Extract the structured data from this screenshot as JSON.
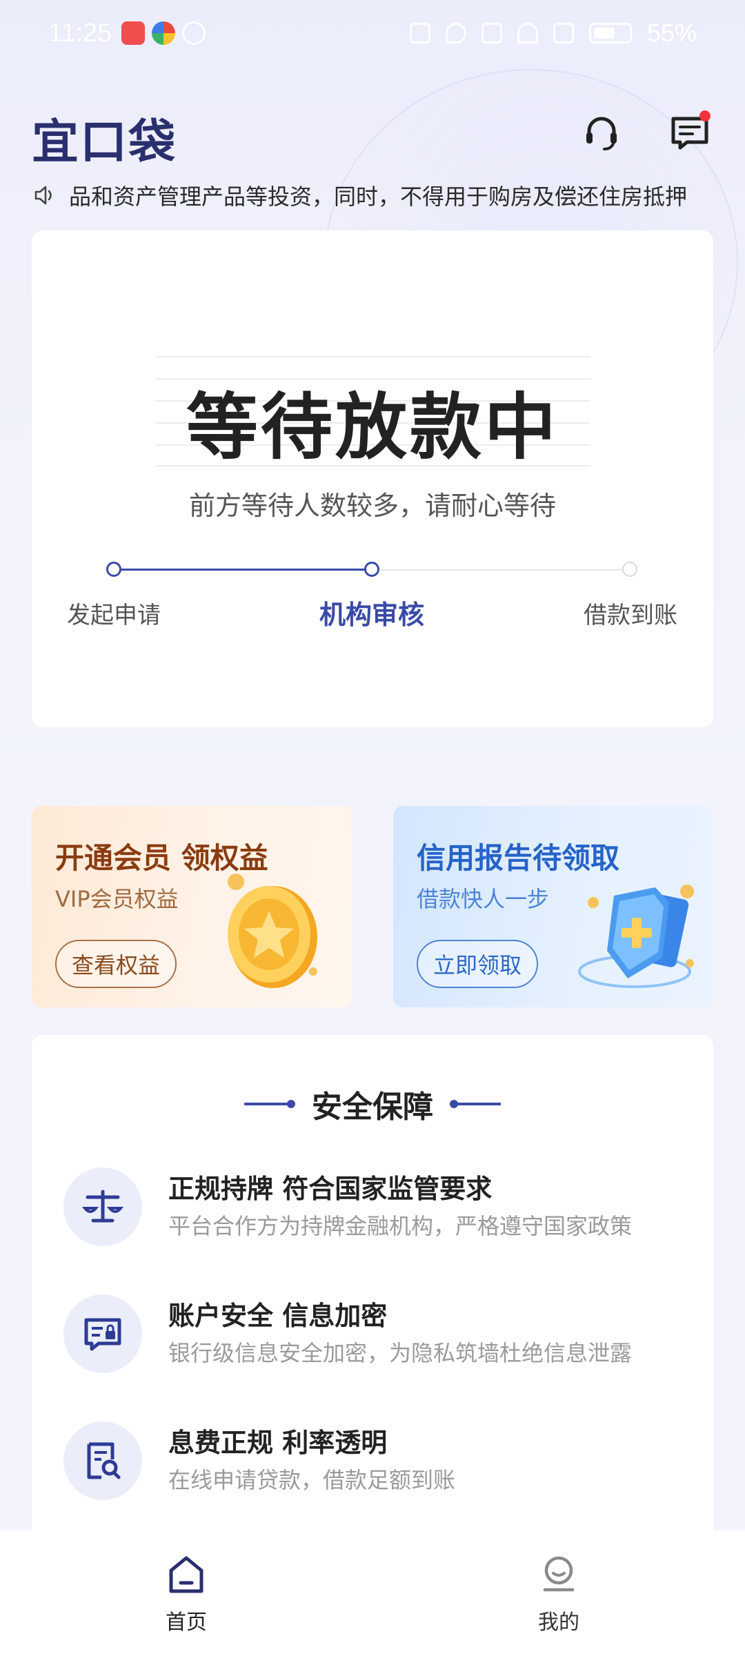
{
  "status_bar": {
    "time": "11:25",
    "battery": "55%"
  },
  "header": {
    "logo": "宜口袋",
    "icons": [
      "headset-icon",
      "message-icon"
    ]
  },
  "notice": {
    "text": "品和资产管理产品等投资，同时，不得用于购房及偿还住房抵押"
  },
  "loan_status": {
    "title": "等待放款中",
    "subtitle": "前方等待人数较多，请耐心等待",
    "steps": [
      {
        "label": "发起申请",
        "state": "done"
      },
      {
        "label": "机构审核",
        "state": "current"
      },
      {
        "label": "借款到账",
        "state": "pending"
      }
    ],
    "accent_color": "#3a4aa6"
  },
  "promos": {
    "vip": {
      "title": "开通会员 领权益",
      "subtitle": "VIP会员权益",
      "button": "查看权益"
    },
    "credit": {
      "title": "信用报告待领取",
      "subtitle": "借款快人一步",
      "button": "立即领取"
    }
  },
  "safety": {
    "title": "安全保障",
    "features": [
      {
        "icon": "scale-icon",
        "title": "正规持牌 符合国家监管要求",
        "desc": "平台合作方为持牌金融机构，严格遵守国家政策"
      },
      {
        "icon": "secure-card-icon",
        "title": "账户安全 信息加密",
        "desc": "银行级信息安全加密，为隐私筑墙杜绝信息泄露"
      },
      {
        "icon": "document-search-icon",
        "title": "息费正规  利率透明",
        "desc": "在线申请贷款，借款足额到账"
      }
    ]
  },
  "bottom_nav": {
    "home": "首页",
    "mine": "我的"
  }
}
